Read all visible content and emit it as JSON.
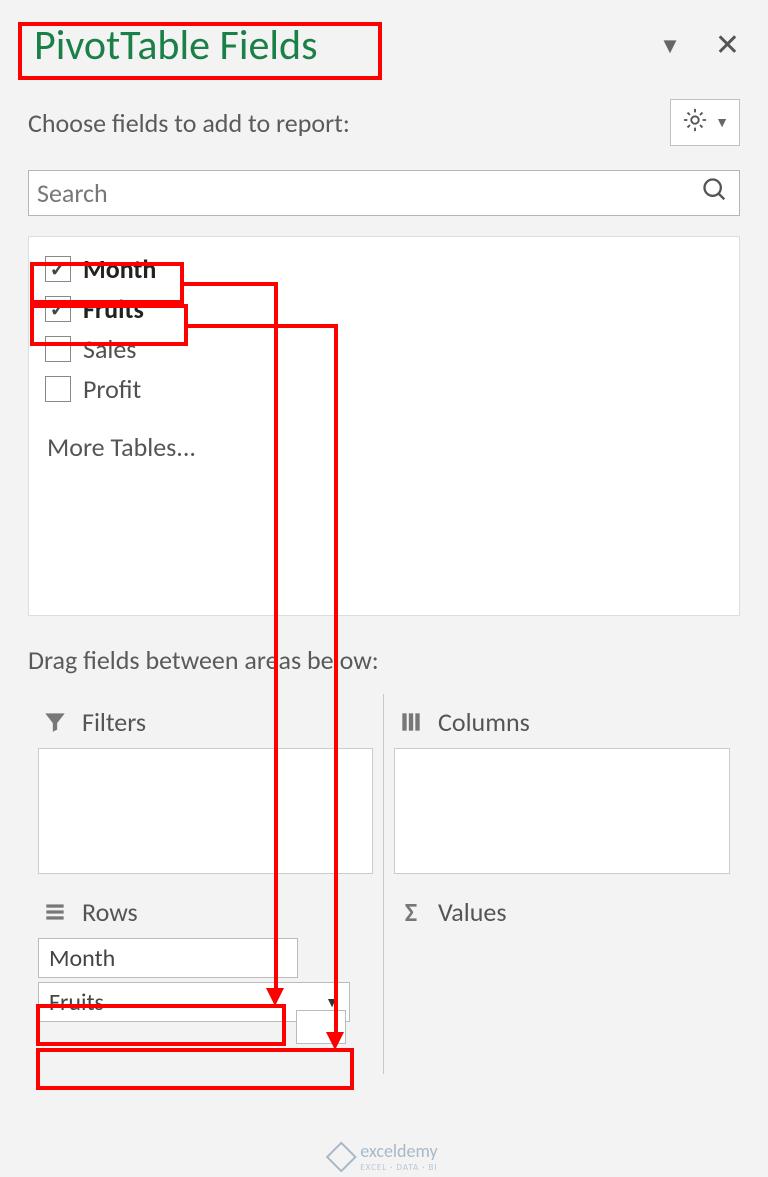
{
  "header": {
    "title": "PivotTable Fields"
  },
  "subtitle": "Choose fields to add to report:",
  "search": {
    "placeholder": "Search"
  },
  "fields": {
    "items": [
      {
        "label": "Month",
        "checked": true
      },
      {
        "label": "Fruits",
        "checked": true
      },
      {
        "label": "Sales",
        "checked": false
      },
      {
        "label": "Profit",
        "checked": false
      }
    ],
    "more": "More Tables..."
  },
  "areas": {
    "label": "Drag fields between areas below:",
    "filters": {
      "title": "Filters"
    },
    "columns": {
      "title": "Columns"
    },
    "rows": {
      "title": "Rows",
      "items": [
        {
          "label": "Month"
        },
        {
          "label": "Fruits"
        }
      ]
    },
    "values": {
      "title": "Values"
    }
  },
  "watermark": {
    "brand": "exceldemy",
    "tagline": "EXCEL · DATA · BI"
  }
}
